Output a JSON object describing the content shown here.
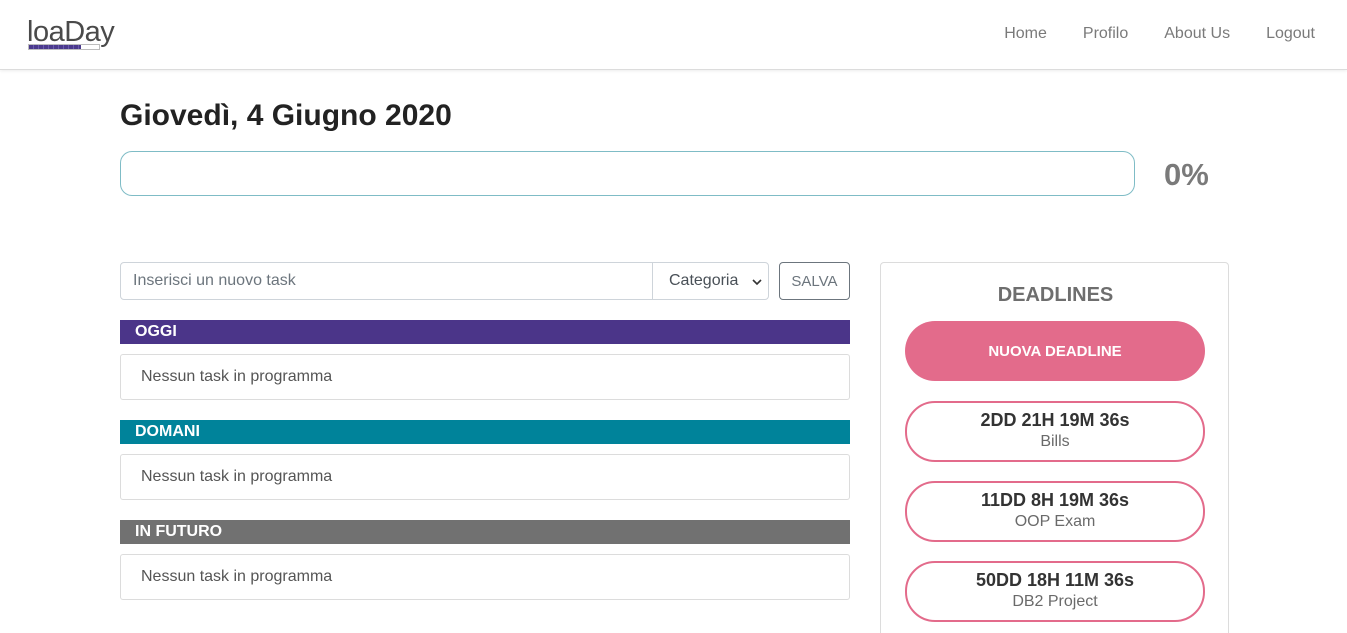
{
  "brand": {
    "name": "loaDay"
  },
  "nav": {
    "links": [
      "Home",
      "Profilo",
      "About Us",
      "Logout"
    ]
  },
  "page": {
    "date_title": "Giovedì, 4 Giugno 2020",
    "progress_value": 0,
    "progress_label": "0%"
  },
  "task_form": {
    "placeholder": "Inserisci un nuovo task",
    "category_selected": "Categoria",
    "save_label": "SALVA"
  },
  "sections": [
    {
      "title": "OGGI",
      "color": "#4b3589",
      "empty_text": "Nessun task in programma"
    },
    {
      "title": "DOMANI",
      "color": "#00839a",
      "empty_text": "Nessun task in programma"
    },
    {
      "title": "IN FUTURO",
      "color": "#717171",
      "empty_text": "Nessun task in programma"
    }
  ],
  "deadlines": {
    "title": "DEADLINES",
    "new_label": "NUOVA DEADLINE",
    "accent": "#e36b8b",
    "items": [
      {
        "countdown": "2DD 21H 19M 36s",
        "name": "Bills"
      },
      {
        "countdown": "11DD 8H 19M 36s",
        "name": "OOP Exam"
      },
      {
        "countdown": "50DD 18H 11M 36s",
        "name": "DB2 Project"
      }
    ]
  }
}
